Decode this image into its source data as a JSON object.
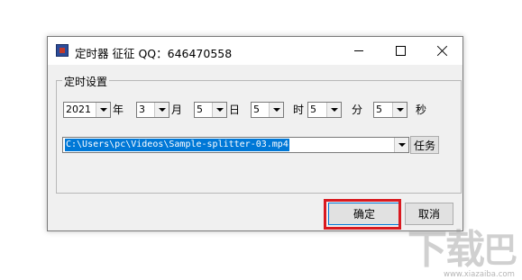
{
  "window": {
    "title": "定时器 征征 QQ：646470558"
  },
  "group": {
    "legend": "定时设置"
  },
  "time": {
    "year": "2021",
    "year_unit": "年",
    "month": "3",
    "month_unit": "月",
    "day": "5",
    "day_unit": "日",
    "hour": "5",
    "hour_unit": "时",
    "minute": "5",
    "minute_unit": "分",
    "second": "5",
    "second_unit": "秒"
  },
  "file": {
    "path": "C:\\Users\\pc\\Videos\\Sample-splitter-03.mp4",
    "task_label": "任务"
  },
  "buttons": {
    "ok_label": "确定",
    "cancel_label": "取消"
  },
  "watermark": {
    "url": "www.xiazaiba.com"
  }
}
